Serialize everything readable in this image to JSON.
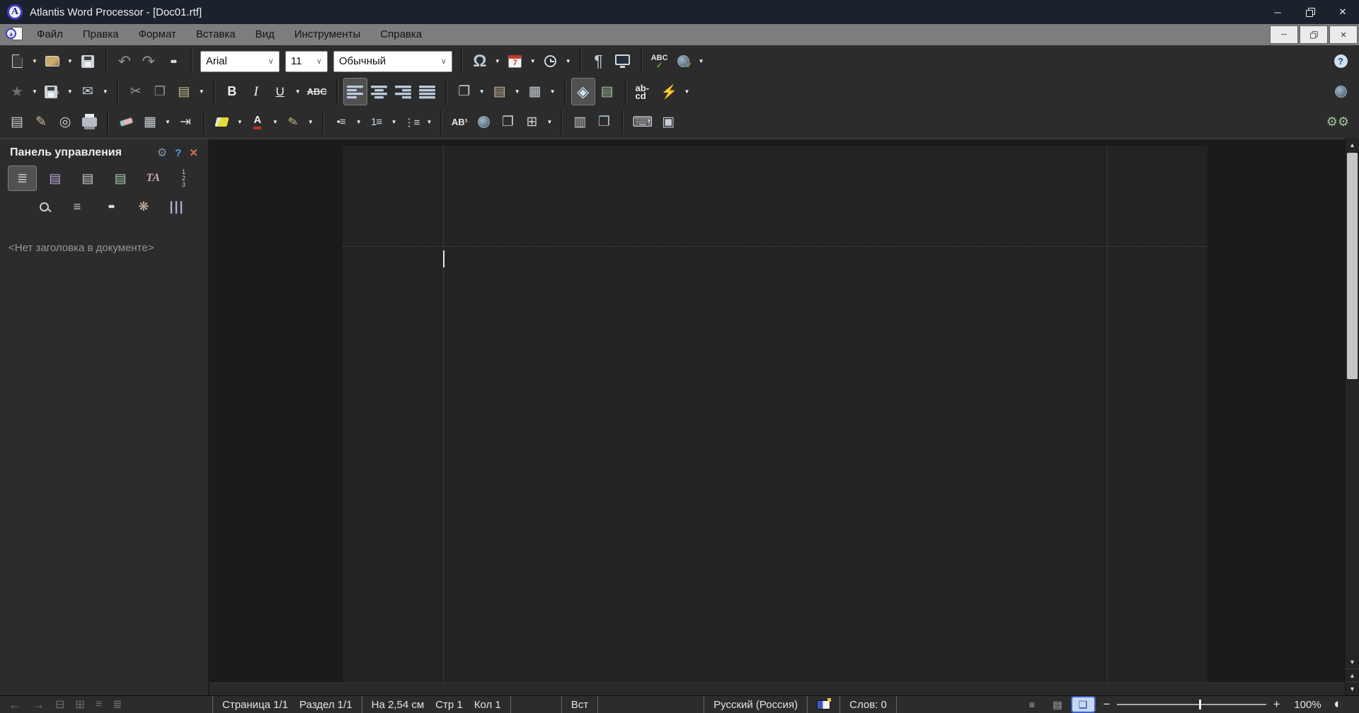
{
  "window": {
    "title": "Atlantis Word Processor - [Doc01.rtf]",
    "logo_letter": "A"
  },
  "menu": {
    "items": [
      "Файл",
      "Правка",
      "Формат",
      "Вставка",
      "Вид",
      "Инструменты",
      "Справка"
    ]
  },
  "toolbar": {
    "font_family": "Arial",
    "font_size": "11",
    "paragraph_style": "Обычный"
  },
  "icons": {
    "dropdown": "▼",
    "chevron": "∨",
    "minimize": "─",
    "close": "✕",
    "help": "?",
    "undo": "↶",
    "redo": "↷",
    "binoculars": "●●",
    "star": "★",
    "pencil": "✎",
    "envelope": "✉",
    "scissors": "✂",
    "copy": "❐",
    "paste": "▤",
    "bold": "B",
    "italic": "I",
    "underline": "U",
    "strikethrough": "ABC",
    "omega": "Ω",
    "calendar_day": "7",
    "pilcrow": "¶",
    "spell_abc": "ABC",
    "check": "✓",
    "diamond": "◈",
    "doc_props": "▤",
    "hyphenation": "ab-cd",
    "lightning": "⚡",
    "mail_merge": "▤",
    "doc_edit": "✎",
    "doc_preview": "◎",
    "table_borders": "▦",
    "indent": "⇥",
    "font_a": "A",
    "bullets": "•≡",
    "numbering": "1≡",
    "multilevel": "⋮≡",
    "footnote": "AB¹",
    "copy_sheet": "❐",
    "table": "⊞",
    "columns": "▥",
    "booklet": "❐",
    "keyboard": "⌨",
    "screenshot": "▣",
    "insert_file": "❐",
    "insert_picture": "▤",
    "insert_frame": "▦",
    "gear": "⚙",
    "panel_lines": "≡",
    "palette": "❋",
    "clips": "|||",
    "fonts": "ТА",
    "numbers": "1 2 3",
    "outline": "≣",
    "doc_styles": "▤",
    "doc_notes": "▤",
    "doc_marks": "▤",
    "nav_back": "←",
    "nav_forward": "→",
    "nav1": "⊟",
    "nav2": "⊞",
    "nav3": "≡",
    "nav4": "≣",
    "view_draft": "≡",
    "view_web": "▤",
    "view_page": "❑",
    "contrast": "◐",
    "up": "▲",
    "down": "▼"
  },
  "panel": {
    "title": "Панель управления",
    "no_heading": "<Нет заголовка в документе>"
  },
  "statusbar": {
    "page": "Страница 1/1",
    "section": "Раздел 1/1",
    "position_cm": "На 2,54 см",
    "position_line": "Стр 1",
    "position_col": "Кол 1",
    "insert_mode": "Вст",
    "language": "Русский (Россия)",
    "words": "Слов: 0",
    "zoom_percent": "100%",
    "zoom_out": "−",
    "zoom_in": "+"
  }
}
